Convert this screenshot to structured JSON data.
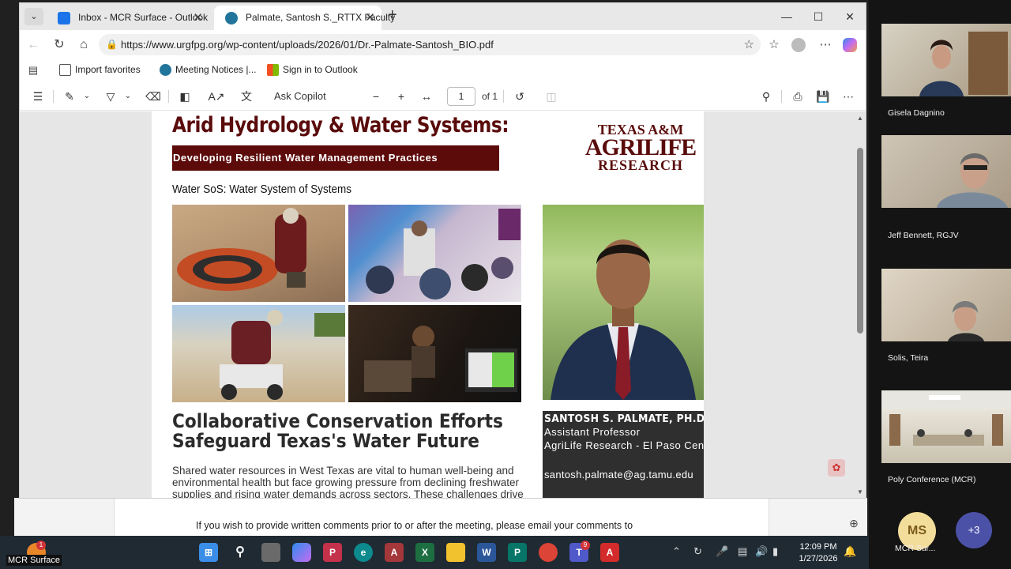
{
  "browser": {
    "tabs": [
      {
        "label": "Inbox - MCR Surface - Outlook",
        "active": false
      },
      {
        "label": "Palmate, Santosh S._RTTX Faculty",
        "active": true
      }
    ],
    "url": "https://www.urgfpg.org/wp-content/uploads/2026/01/Dr.-Palmate-Santosh_BIO.pdf",
    "favorites": [
      "Import favorites",
      "Meeting Notices |...",
      "Sign in to Outlook"
    ],
    "pdf_toolbar": {
      "ask_copilot": "Ask Copilot",
      "page_current": "1",
      "page_total": "of 1"
    }
  },
  "pdf": {
    "title": "Arid Hydrology & Water Systems:",
    "subtitle": "Developing Resilient Water Management Practices",
    "logo": {
      "line1": "TEXAS A&M",
      "line2": "AGRILIFE",
      "line3": "RESEARCH"
    },
    "section_label": "Water SoS: Water System of Systems",
    "headline": "Collaborative Conservation Efforts Safeguard Texas's Water Future",
    "body": "Shared water resources in West Texas are vital to human well-being and environmental health but face growing pressure from declining freshwater supplies and rising water demands across sectors. These challenges drive",
    "profile": {
      "name": "SANTOSH S. PALMATE, PH.D.",
      "role": "Assistant Professor",
      "org": "AgriLife Research - El Paso Center",
      "email": "santosh.palmate@ag.tamu.edu"
    }
  },
  "background_page": {
    "text": "If you wish to provide written comments prior to or after the meeting, please email your comments to"
  },
  "teams": {
    "participants": [
      {
        "name": "Gisela Dagnino"
      },
      {
        "name": "Jeff Bennett, RGJV"
      },
      {
        "name": "Solis, Teira"
      },
      {
        "name": "Poly Conference (MCR)"
      }
    ],
    "self": {
      "initials": "MS",
      "name": "MCR Sur..."
    },
    "overflow": "+3"
  },
  "taskbar": {
    "label": "MCR Surface",
    "time": "12:09 PM",
    "date": "1/27/2026",
    "badges": {
      "weather": "1",
      "teams": "9"
    }
  }
}
